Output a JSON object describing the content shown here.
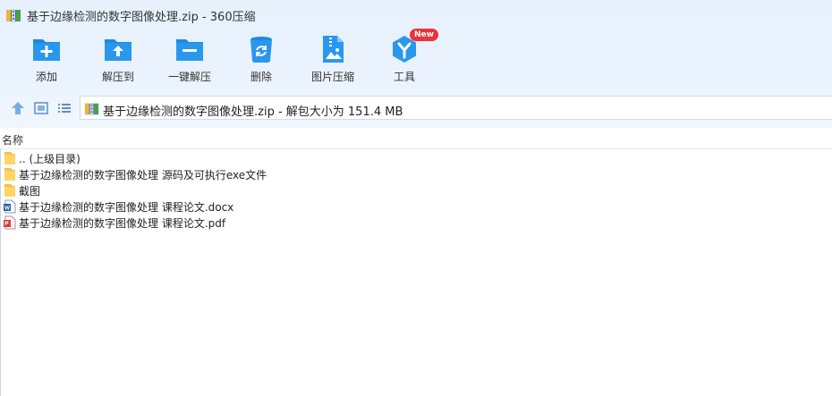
{
  "window": {
    "title": "基于边缘检测的数字图像处理.zip - 360压缩"
  },
  "toolbar": {
    "items": [
      {
        "label": "添加",
        "icon": "add-folder-icon"
      },
      {
        "label": "解压到",
        "icon": "extract-folder-icon"
      },
      {
        "label": "一键解压",
        "icon": "one-click-extract-icon"
      },
      {
        "label": "删除",
        "icon": "recycle-bin-icon"
      },
      {
        "label": "图片压缩",
        "icon": "image-compress-icon"
      },
      {
        "label": "工具",
        "icon": "tools-icon",
        "badge": "New"
      }
    ]
  },
  "nav": {
    "path_text": "基于边缘检测的数字图像处理.zip - 解包大小为 151.4 MB"
  },
  "list": {
    "column_name": "名称",
    "rows": [
      {
        "name": ".. (上级目录)",
        "type": "folder"
      },
      {
        "name": "基于边缘检测的数字图像处理 源码及可执行exe文件",
        "type": "folder"
      },
      {
        "name": "截图",
        "type": "folder"
      },
      {
        "name": "基于边缘检测的数字图像处理 课程论文.docx",
        "type": "docx"
      },
      {
        "name": "基于边缘检测的数字图像处理 课程论文.pdf",
        "type": "pdf"
      }
    ]
  },
  "colors": {
    "accent": "#2a8fe0",
    "toolbar_bg": "#e8f2fc",
    "new_badge": "#e8343a"
  }
}
